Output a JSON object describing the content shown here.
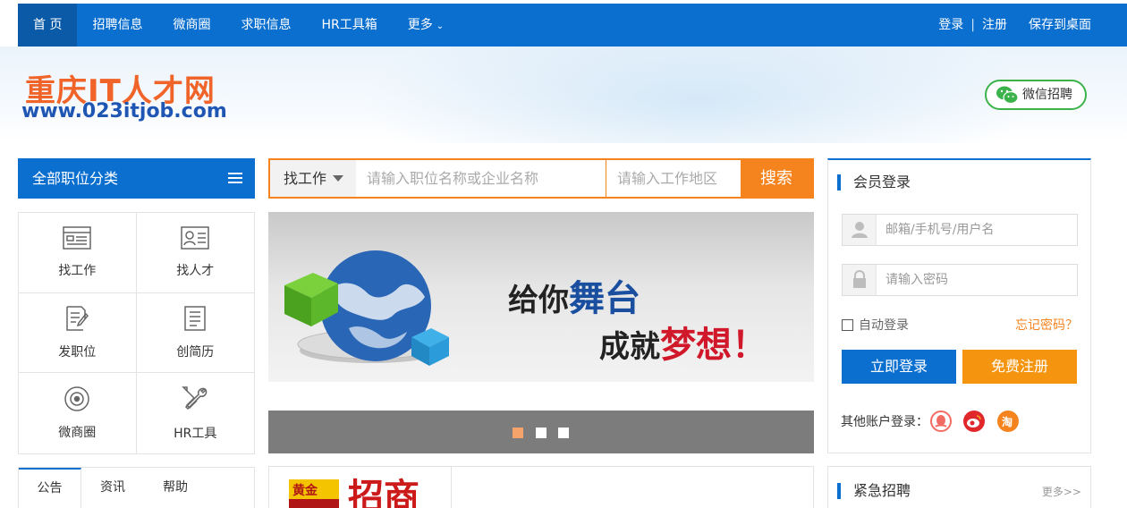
{
  "nav": {
    "items": [
      "首 页",
      "招聘信息",
      "微商圈",
      "求职信息",
      "HR工具箱",
      "更多"
    ],
    "login": "登录",
    "separator": "|",
    "register": "注册",
    "save_desktop": "保存到桌面"
  },
  "logo": {
    "cn": "重庆IT人才网",
    "url": "www.023itjob.com"
  },
  "wechat_button": "微信招聘",
  "category": {
    "title": "全部职位分类",
    "cells": [
      "找工作",
      "找人才",
      "发职位",
      "创简历",
      "微商圈",
      "HR工具"
    ]
  },
  "tabs": [
    "公告",
    "资讯",
    "帮助"
  ],
  "search": {
    "type_label": "找工作",
    "keyword_placeholder": "请输入职位名称或企业名称",
    "area_placeholder": "请输入工作地区",
    "button": "搜索"
  },
  "slider": {
    "line1_a": "给你",
    "line1_b": "舞台",
    "line2_a": "成就",
    "line2_b": "梦想！",
    "active_dot": 1,
    "dot_count": 3
  },
  "ad": {
    "badge": "黄金",
    "big_text": "招商"
  },
  "login_panel": {
    "title": "会员登录",
    "username_placeholder": "邮箱/手机号/用户名",
    "password_placeholder": "请输入密码",
    "auto_login": "自动登录",
    "forgot": "忘记密码？",
    "login_button": "立即登录",
    "register_button": "免费注册",
    "other_login": "其他账户登录："
  },
  "urgent": {
    "title": "紧急招聘",
    "more": "更多>>"
  },
  "colors": {
    "brand_blue": "#0b6fd0",
    "accent_orange": "#f5841f",
    "wechat_green": "#3bb24a"
  }
}
